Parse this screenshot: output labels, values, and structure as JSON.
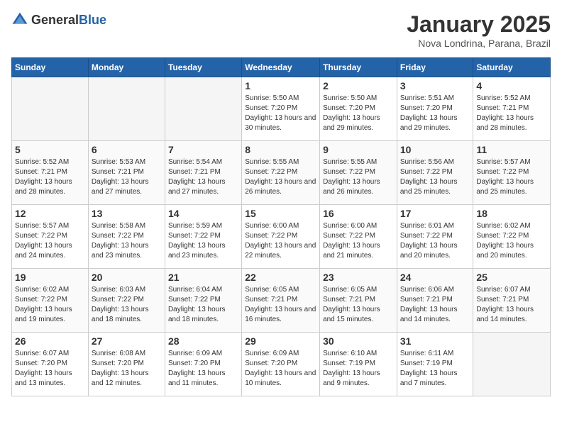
{
  "logo": {
    "general": "General",
    "blue": "Blue"
  },
  "header": {
    "title": "January 2025",
    "subtitle": "Nova Londrina, Parana, Brazil"
  },
  "weekdays": [
    "Sunday",
    "Monday",
    "Tuesday",
    "Wednesday",
    "Thursday",
    "Friday",
    "Saturday"
  ],
  "weeks": [
    [
      {
        "day": "",
        "empty": true
      },
      {
        "day": "",
        "empty": true
      },
      {
        "day": "",
        "empty": true
      },
      {
        "day": "1",
        "sunrise": "Sunrise: 5:50 AM",
        "sunset": "Sunset: 7:20 PM",
        "daylight": "Daylight: 13 hours and 30 minutes."
      },
      {
        "day": "2",
        "sunrise": "Sunrise: 5:50 AM",
        "sunset": "Sunset: 7:20 PM",
        "daylight": "Daylight: 13 hours and 29 minutes."
      },
      {
        "day": "3",
        "sunrise": "Sunrise: 5:51 AM",
        "sunset": "Sunset: 7:20 PM",
        "daylight": "Daylight: 13 hours and 29 minutes."
      },
      {
        "day": "4",
        "sunrise": "Sunrise: 5:52 AM",
        "sunset": "Sunset: 7:21 PM",
        "daylight": "Daylight: 13 hours and 28 minutes."
      }
    ],
    [
      {
        "day": "5",
        "sunrise": "Sunrise: 5:52 AM",
        "sunset": "Sunset: 7:21 PM",
        "daylight": "Daylight: 13 hours and 28 minutes."
      },
      {
        "day": "6",
        "sunrise": "Sunrise: 5:53 AM",
        "sunset": "Sunset: 7:21 PM",
        "daylight": "Daylight: 13 hours and 27 minutes."
      },
      {
        "day": "7",
        "sunrise": "Sunrise: 5:54 AM",
        "sunset": "Sunset: 7:21 PM",
        "daylight": "Daylight: 13 hours and 27 minutes."
      },
      {
        "day": "8",
        "sunrise": "Sunrise: 5:55 AM",
        "sunset": "Sunset: 7:22 PM",
        "daylight": "Daylight: 13 hours and 26 minutes."
      },
      {
        "day": "9",
        "sunrise": "Sunrise: 5:55 AM",
        "sunset": "Sunset: 7:22 PM",
        "daylight": "Daylight: 13 hours and 26 minutes."
      },
      {
        "day": "10",
        "sunrise": "Sunrise: 5:56 AM",
        "sunset": "Sunset: 7:22 PM",
        "daylight": "Daylight: 13 hours and 25 minutes."
      },
      {
        "day": "11",
        "sunrise": "Sunrise: 5:57 AM",
        "sunset": "Sunset: 7:22 PM",
        "daylight": "Daylight: 13 hours and 25 minutes."
      }
    ],
    [
      {
        "day": "12",
        "sunrise": "Sunrise: 5:57 AM",
        "sunset": "Sunset: 7:22 PM",
        "daylight": "Daylight: 13 hours and 24 minutes."
      },
      {
        "day": "13",
        "sunrise": "Sunrise: 5:58 AM",
        "sunset": "Sunset: 7:22 PM",
        "daylight": "Daylight: 13 hours and 23 minutes."
      },
      {
        "day": "14",
        "sunrise": "Sunrise: 5:59 AM",
        "sunset": "Sunset: 7:22 PM",
        "daylight": "Daylight: 13 hours and 23 minutes."
      },
      {
        "day": "15",
        "sunrise": "Sunrise: 6:00 AM",
        "sunset": "Sunset: 7:22 PM",
        "daylight": "Daylight: 13 hours and 22 minutes."
      },
      {
        "day": "16",
        "sunrise": "Sunrise: 6:00 AM",
        "sunset": "Sunset: 7:22 PM",
        "daylight": "Daylight: 13 hours and 21 minutes."
      },
      {
        "day": "17",
        "sunrise": "Sunrise: 6:01 AM",
        "sunset": "Sunset: 7:22 PM",
        "daylight": "Daylight: 13 hours and 20 minutes."
      },
      {
        "day": "18",
        "sunrise": "Sunrise: 6:02 AM",
        "sunset": "Sunset: 7:22 PM",
        "daylight": "Daylight: 13 hours and 20 minutes."
      }
    ],
    [
      {
        "day": "19",
        "sunrise": "Sunrise: 6:02 AM",
        "sunset": "Sunset: 7:22 PM",
        "daylight": "Daylight: 13 hours and 19 minutes."
      },
      {
        "day": "20",
        "sunrise": "Sunrise: 6:03 AM",
        "sunset": "Sunset: 7:22 PM",
        "daylight": "Daylight: 13 hours and 18 minutes."
      },
      {
        "day": "21",
        "sunrise": "Sunrise: 6:04 AM",
        "sunset": "Sunset: 7:22 PM",
        "daylight": "Daylight: 13 hours and 18 minutes."
      },
      {
        "day": "22",
        "sunrise": "Sunrise: 6:05 AM",
        "sunset": "Sunset: 7:21 PM",
        "daylight": "Daylight: 13 hours and 16 minutes."
      },
      {
        "day": "23",
        "sunrise": "Sunrise: 6:05 AM",
        "sunset": "Sunset: 7:21 PM",
        "daylight": "Daylight: 13 hours and 15 minutes."
      },
      {
        "day": "24",
        "sunrise": "Sunrise: 6:06 AM",
        "sunset": "Sunset: 7:21 PM",
        "daylight": "Daylight: 13 hours and 14 minutes."
      },
      {
        "day": "25",
        "sunrise": "Sunrise: 6:07 AM",
        "sunset": "Sunset: 7:21 PM",
        "daylight": "Daylight: 13 hours and 14 minutes."
      }
    ],
    [
      {
        "day": "26",
        "sunrise": "Sunrise: 6:07 AM",
        "sunset": "Sunset: 7:20 PM",
        "daylight": "Daylight: 13 hours and 13 minutes."
      },
      {
        "day": "27",
        "sunrise": "Sunrise: 6:08 AM",
        "sunset": "Sunset: 7:20 PM",
        "daylight": "Daylight: 13 hours and 12 minutes."
      },
      {
        "day": "28",
        "sunrise": "Sunrise: 6:09 AM",
        "sunset": "Sunset: 7:20 PM",
        "daylight": "Daylight: 13 hours and 11 minutes."
      },
      {
        "day": "29",
        "sunrise": "Sunrise: 6:09 AM",
        "sunset": "Sunset: 7:20 PM",
        "daylight": "Daylight: 13 hours and 10 minutes."
      },
      {
        "day": "30",
        "sunrise": "Sunrise: 6:10 AM",
        "sunset": "Sunset: 7:19 PM",
        "daylight": "Daylight: 13 hours and 9 minutes."
      },
      {
        "day": "31",
        "sunrise": "Sunrise: 6:11 AM",
        "sunset": "Sunset: 7:19 PM",
        "daylight": "Daylight: 13 hours and 7 minutes."
      },
      {
        "day": "",
        "empty": true
      }
    ]
  ]
}
